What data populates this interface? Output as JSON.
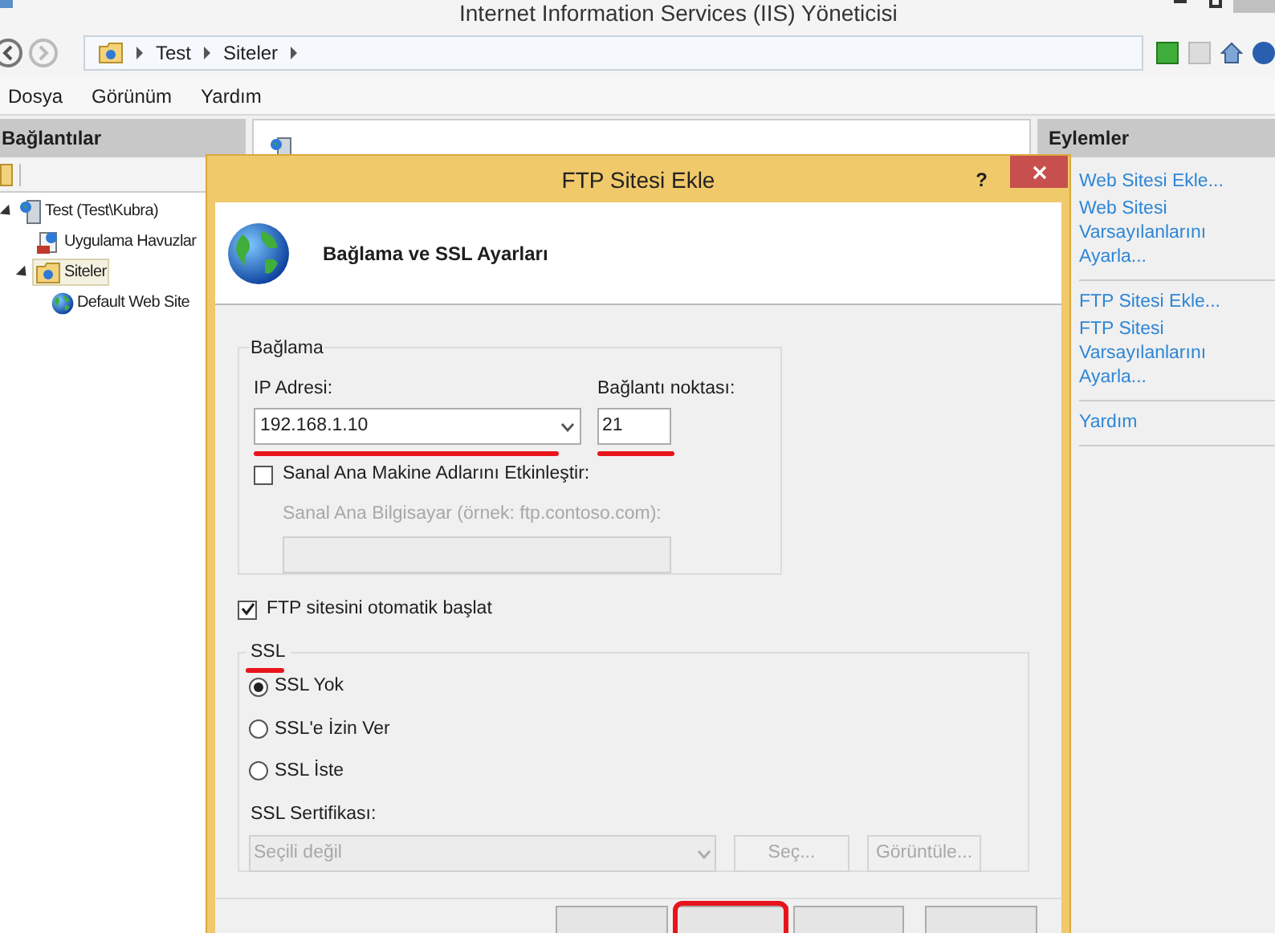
{
  "window": {
    "title": "Internet Information Services (IIS) Yöneticisi"
  },
  "breadcrumbs": [
    "Test",
    "Siteler"
  ],
  "menu": [
    "Dosya",
    "Görünüm",
    "Yardım"
  ],
  "connections": {
    "title": "Bağlantılar",
    "tree": [
      {
        "label": "Test (Test\\Kubra)",
        "kind": "server",
        "expanded": true,
        "selected": false,
        "children": [
          {
            "label": "Uygulama Havuzlar",
            "kind": "pool",
            "selected": false
          },
          {
            "label": "Siteler",
            "kind": "folder",
            "expanded": true,
            "selected": true,
            "children": [
              {
                "label": "Default Web Site",
                "kind": "site",
                "selected": false
              }
            ]
          }
        ]
      }
    ]
  },
  "actions": {
    "title": "Eylemler",
    "groups": [
      [
        "Web Sitesi Ekle...",
        "Web Sitesi Varsayılanlarını Ayarla..."
      ],
      [
        "FTP Sitesi Ekle...",
        "FTP Sitesi Varsayılanlarını Ayarla..."
      ],
      [
        "Yardım"
      ]
    ]
  },
  "dialog": {
    "title": "FTP Sitesi Ekle",
    "help": "?",
    "header": "Bağlama ve SSL Ayarları",
    "binding": {
      "legend": "Bağlama",
      "ip_label": "IP Adresi:",
      "ip_value": "192.168.1.10",
      "port_label": "Bağlantı noktası:",
      "port_value": "21",
      "virtual_host": {
        "label": "Sanal Ana Makine Adlarını Etkinleştir:",
        "checked": false
      },
      "host_label": "Sanal Ana Bilgisayar (örnek: ftp.contoso.com):",
      "host_disabled": true
    },
    "autostart": {
      "label": "FTP sitesini otomatik başlat",
      "checked": true
    },
    "ssl": {
      "legend": "SSL",
      "options": [
        {
          "label": "SSL Yok",
          "selected": true
        },
        {
          "label": "SSL'e İzin Ver",
          "selected": false
        },
        {
          "label": "SSL İste",
          "selected": false
        }
      ],
      "cert_label": "SSL Sertifikası:",
      "cert_value": "Seçili değil",
      "buttons": [
        "Seç...",
        "Görüntüle..."
      ],
      "disabled": true
    },
    "footer_buttons": [
      {
        "highlighted": false
      },
      {
        "highlighted": true
      },
      {
        "highlighted": false
      },
      {
        "highlighted": false
      }
    ]
  }
}
